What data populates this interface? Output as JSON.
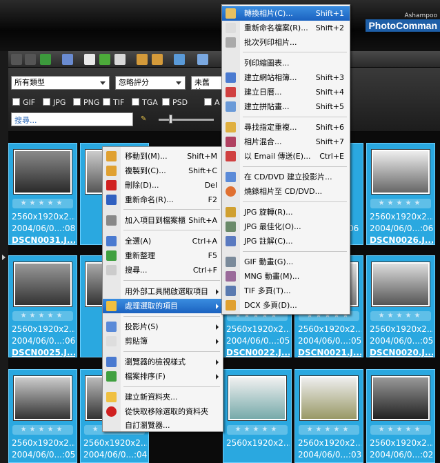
{
  "brand": {
    "small": "Ashampoo",
    "big": "PhotoComman"
  },
  "filters": {
    "type_select": "所有類型",
    "rating_select": "忽略評分",
    "date_select": "未舊於.",
    "formats": [
      "GIF",
      "JPG",
      "PNG",
      "TIF",
      "TGA",
      "PSD",
      "A"
    ],
    "search_placeholder": "搜尋..."
  },
  "thumbs": [
    {
      "stars": "★★★★★",
      "res": "2560x1920x2...",
      "date": "2004/06/0...:08",
      "name": "DSCN0031.J..."
    },
    {
      "stars": "★★★★★",
      "res": "2560x1920x2...",
      "date": "2004/06/0...:06",
      "name": "DSCN0026.J..."
    },
    {
      "stars": "★★★★★",
      "res": "2560x1920x2...",
      "date": "2004/06/0...:06",
      "name": "DSCN0025.J..."
    },
    {
      "stars": "★★★★★",
      "res": "2560x1920x2...",
      "date": "2004/06/0...:05",
      "name": "DSCN0022.J..."
    },
    {
      "stars": "★★★★★",
      "res": "2560x1920x2...",
      "date": "2004/06/0...:05",
      "name": "DSCN0021.J..."
    },
    {
      "stars": "★★★★★",
      "res": "2560x1920x2...",
      "date": "2004/06/0...:05",
      "name": "DSCN0020.J..."
    },
    {
      "stars": "★★★★★",
      "res": "2560x1920x2...",
      "date": "2004/06/0...:05",
      "name": ""
    },
    {
      "stars": "★★★★★",
      "res": "2560x1920x2...",
      "date": "2004/06/0...:04",
      "name": ""
    },
    {
      "stars": "★★★★★",
      "res": "2560x1920x2...",
      "date": "2004/06/0...:03",
      "name": ""
    },
    {
      "stars": "★★★★★",
      "res": "2560x1920x2...",
      "date": "2004/06/0...:02",
      "name": ""
    },
    {
      "stars": "★★★★★",
      "res": "2560x1920x2...",
      "date": "",
      "name": ""
    },
    {
      "stars": "★★★★★",
      "res": "",
      "date": "",
      "name": ""
    }
  ],
  "partial_text": {
    "row1_mid": "06",
    "row2_mid_date": "...:06"
  },
  "context_menu": {
    "items": [
      {
        "label": "移動到(M)...",
        "shortcut": "Shift+M",
        "icon": "move-icon"
      },
      {
        "label": "複製到(C)...",
        "shortcut": "Shift+C",
        "icon": "copy-icon"
      },
      {
        "label": "刪除(D)...",
        "shortcut": "Del",
        "icon": "delete-icon"
      },
      {
        "label": "重新命名(R)...",
        "shortcut": "F2",
        "icon": "rename-icon"
      },
      {
        "label": "加入項目到檔案櫃",
        "shortcut": "Shift+A",
        "icon": "cabinet-icon"
      },
      {
        "label": "全選(A)",
        "shortcut": "Ctrl+A",
        "icon": "select-all-icon"
      },
      {
        "label": "重新整理",
        "shortcut": "F5",
        "icon": "refresh-icon"
      },
      {
        "label": "搜尋...",
        "shortcut": "Ctrl+F",
        "icon": "search-icon"
      },
      {
        "label": "用外部工具開啟選取項目",
        "shortcut": "",
        "icon": ""
      },
      {
        "label": "處理選取的項目",
        "shortcut": "",
        "icon": "process-icon"
      },
      {
        "label": "投影片(S)",
        "shortcut": "",
        "icon": "slideshow-icon"
      },
      {
        "label": "剪貼簿",
        "shortcut": "",
        "icon": "clipboard-icon"
      },
      {
        "label": "瀏覽器的檢視樣式",
        "shortcut": "",
        "icon": "view-style-icon"
      },
      {
        "label": "檔案排序(F)",
        "shortcut": "",
        "icon": "sort-icon"
      },
      {
        "label": "建立新資料夾...",
        "shortcut": "",
        "icon": "new-folder-icon"
      },
      {
        "label": "從快取移除選取的資料夾",
        "shortcut": "",
        "icon": "remove-cache-icon"
      },
      {
        "label": "自訂瀏覽器...",
        "shortcut": "",
        "icon": ""
      }
    ]
  },
  "sub_menu": {
    "items": [
      {
        "label": "轉換相片(C)...",
        "shortcut": "Shift+1"
      },
      {
        "label": "重新命名檔案(R)...",
        "shortcut": "Shift+2"
      },
      {
        "label": "批次列印相片...",
        "shortcut": ""
      },
      {
        "label": "列印縮圖表...",
        "shortcut": ""
      },
      {
        "label": "建立網站相簿...",
        "shortcut": "Shift+3"
      },
      {
        "label": "建立日曆...",
        "shortcut": "Shift+4"
      },
      {
        "label": "建立拼貼畫...",
        "shortcut": "Shift+5"
      },
      {
        "label": "尋找指定重複...",
        "shortcut": "Shift+6"
      },
      {
        "label": "相片混合...",
        "shortcut": "Shift+7"
      },
      {
        "label": "以 Email 傳送(E)...",
        "shortcut": "Ctrl+E"
      },
      {
        "label": "在 CD/DVD 建立投影片...",
        "shortcut": ""
      },
      {
        "label": "燒錄相片至 CD/DVD...",
        "shortcut": ""
      },
      {
        "label": "JPG 旋轉(R)...",
        "shortcut": ""
      },
      {
        "label": "JPG 最佳化(O)...",
        "shortcut": ""
      },
      {
        "label": "JPG 註解(C)...",
        "shortcut": ""
      },
      {
        "label": "GIF 動畫(G)...",
        "shortcut": ""
      },
      {
        "label": "MNG 動畫(M)...",
        "shortcut": ""
      },
      {
        "label": "TIF 多頁(T)...",
        "shortcut": ""
      },
      {
        "label": "DCX 多頁(D)...",
        "shortcut": ""
      }
    ]
  }
}
